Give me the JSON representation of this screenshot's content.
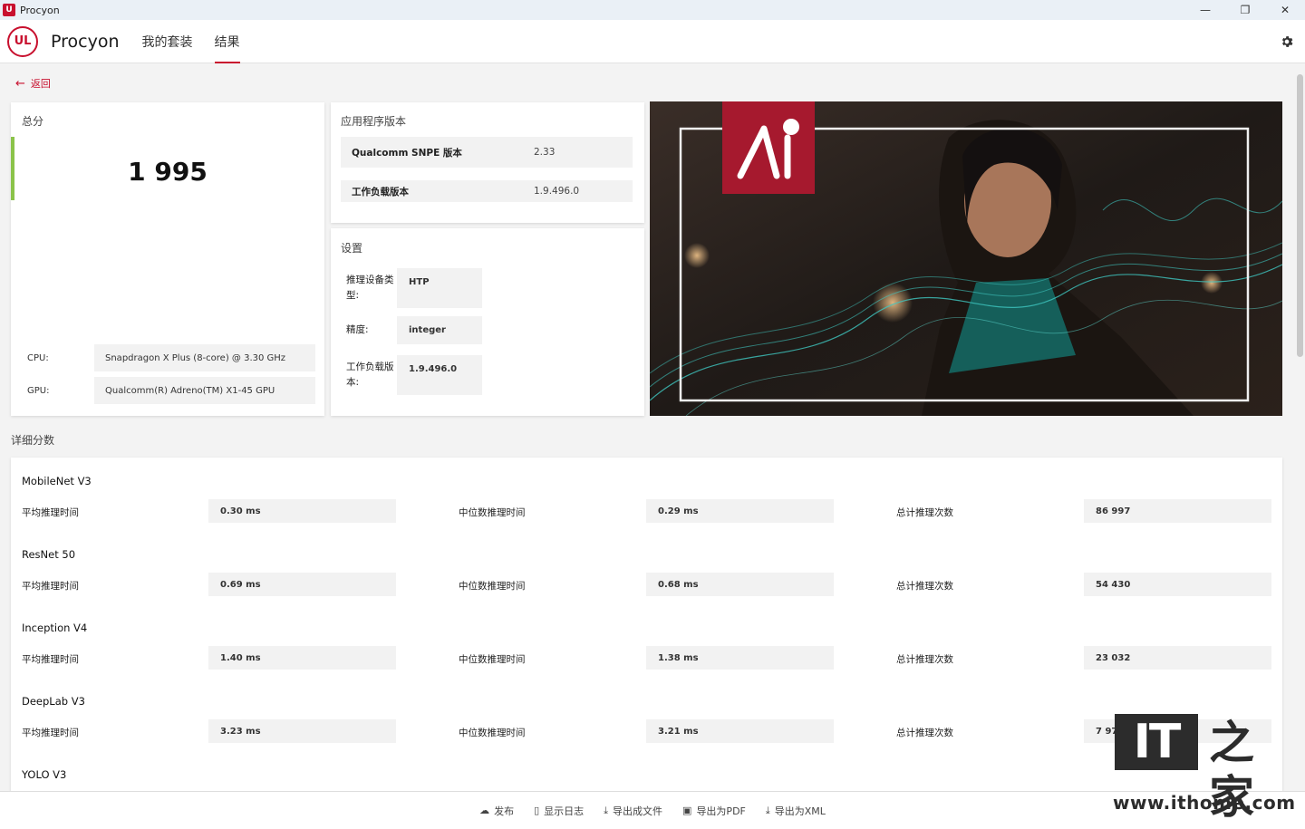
{
  "window": {
    "title": "Procyon",
    "controls": [
      "—",
      "❐",
      "✕"
    ]
  },
  "nav": {
    "brand": "Procyon",
    "logo": "UL",
    "tabs": [
      {
        "label": "我的套装"
      },
      {
        "label": "结果"
      }
    ]
  },
  "back": {
    "label": "返回"
  },
  "score": {
    "title": "总分",
    "value": "1 995",
    "cpu_label": "CPU:",
    "cpu_value": "Snapdragon X Plus (8-core) @ 3.30 GHz",
    "gpu_label": "GPU:",
    "gpu_value": "Qualcomm(R) Adreno(TM) X1-45 GPU",
    "accent_color": "#8bc34a"
  },
  "versions": {
    "title": "应用程序版本",
    "rows": [
      {
        "key": "Qualcomm SNPE 版本",
        "value": "2.33"
      },
      {
        "key": "工作负载版本",
        "value": "1.9.496.0"
      }
    ]
  },
  "settings": {
    "title": "设置",
    "rows": [
      {
        "key": "推理设备类型:",
        "value": "HTP"
      },
      {
        "key": "精度:",
        "value": "integer"
      },
      {
        "key": "工作负载版本:",
        "value": "1.9.496.0"
      }
    ]
  },
  "hero": {
    "badge_text": "AI",
    "badge_color": "#a6192e"
  },
  "details": {
    "title": "详细分数",
    "labels": {
      "avg": "平均推理时间",
      "median": "中位数推理时间",
      "total": "总计推理次数"
    },
    "benchmarks": [
      {
        "name": "MobileNet V3",
        "avg": "0.30 ms",
        "median": "0.29 ms",
        "total": "86 997"
      },
      {
        "name": "ResNet 50",
        "avg": "0.69 ms",
        "median": "0.68 ms",
        "total": "54 430"
      },
      {
        "name": "Inception V4",
        "avg": "1.40 ms",
        "median": "1.38 ms",
        "total": "23 032"
      },
      {
        "name": "DeepLab V3",
        "avg": "3.23 ms",
        "median": "3.21 ms",
        "total": "7 97"
      },
      {
        "name": "YOLO V3"
      }
    ]
  },
  "bottom": {
    "actions": [
      {
        "icon": "cloud-upload-icon",
        "label": "发布"
      },
      {
        "icon": "document-icon",
        "label": "显示日志"
      },
      {
        "icon": "download-icon",
        "label": "导出成文件"
      },
      {
        "icon": "save-icon",
        "label": "导出为PDF"
      },
      {
        "icon": "download-icon",
        "label": "导出为XML"
      }
    ]
  },
  "watermark": {
    "logo": "IT",
    "logo_cn": "之家",
    "url": "www.ithome.com"
  }
}
